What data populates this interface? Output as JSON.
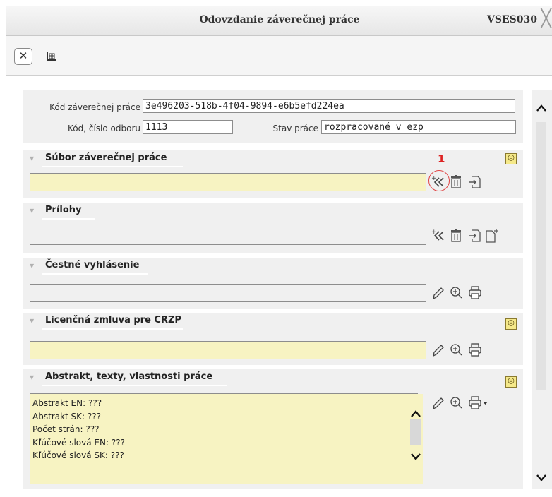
{
  "window": {
    "title": "Odovzdanie záverečnej práce",
    "code": "VSES030",
    "close_glyph": "╳"
  },
  "toolbar": {
    "close_glyph": "✕"
  },
  "form": {
    "kod_label": "Kód záverečnej práce",
    "kod_value": "3e496203-518b-4f04-9894-e6b5efd224ea",
    "odbor_label": "Kód, číslo odboru",
    "odbor_value": "1113",
    "stav_label": "Stav práce",
    "stav_value": "rozpracované v ezp"
  },
  "sections": [
    {
      "title": "Súbor záverečnej práce",
      "warning": true
    },
    {
      "title": "Prílohy",
      "warning": false
    },
    {
      "title": "Čestné vyhlásenie",
      "warning": false
    },
    {
      "title": "Licenčná zmluva pre CRZP",
      "warning": true
    },
    {
      "title": "Abstrakt, texty, vlastnosti práce",
      "warning": true
    }
  ],
  "abstract_lines": [
    "Abstrakt EN: ???",
    "Abstrakt SK: ???",
    "Počet strán: ???",
    "Kľúčové slová EN: ???",
    "Kľúčové slová SK: ???"
  ],
  "annotation": {
    "number": "1",
    "color": "#d22222"
  },
  "colors": {
    "required_field": "#f7f3c2",
    "section_bg": "#f0f0f0",
    "warning_icon": "#f5e98a"
  },
  "icons": [
    "close-icon",
    "grid-icon",
    "upload-icon",
    "trash-icon",
    "import-icon",
    "new-document-icon",
    "edit-icon",
    "zoom-icon",
    "print-icon",
    "sad-face-icon"
  ]
}
